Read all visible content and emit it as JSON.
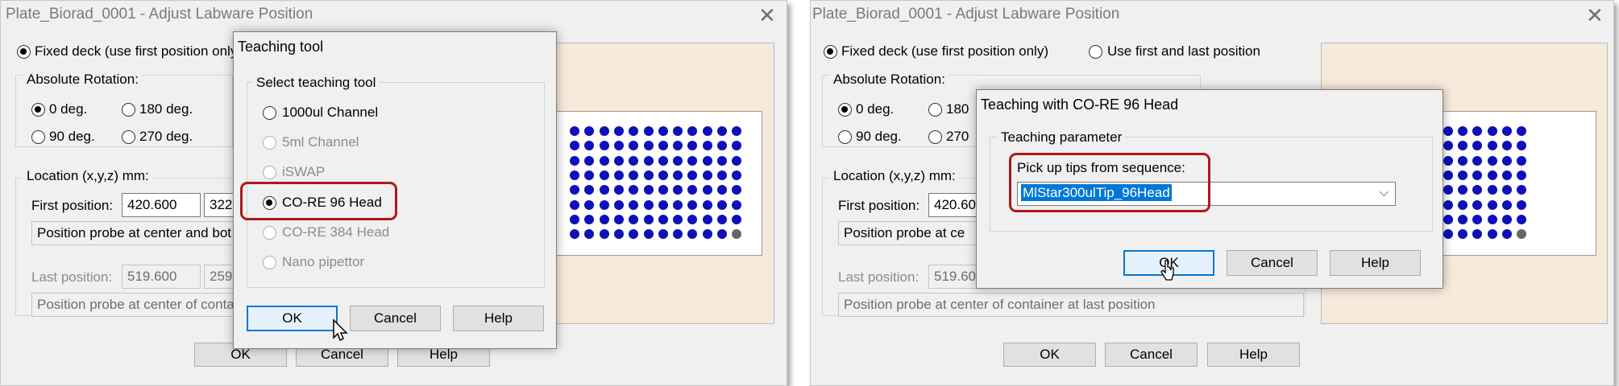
{
  "left": {
    "window_title": "Plate_Biorad_0001 - Adjust Labware Position",
    "fixed_deck_label": "Fixed deck (use first position only)",
    "absolute_rotation_label": "Absolute Rotation:",
    "rot_0": "0 deg.",
    "rot_180": "180 deg.",
    "rot_90": "90 deg.",
    "rot_270": "270 deg.",
    "location_label": "Location (x,y,z) mm:",
    "first_position_label": "First position:",
    "first_x": "420.600",
    "first_y": "322.",
    "first_probe": "Position probe at center and bot",
    "last_position_label": "Last position:",
    "last_x": "519.600",
    "last_y": "259.",
    "last_probe": "Position probe at center of conta",
    "ok": "OK",
    "cancel": "Cancel",
    "help": "Help",
    "teaching_dialog": {
      "title": "Teaching tool",
      "group_label": "Select teaching tool",
      "options": [
        {
          "label": "1000ul Channel",
          "enabled": true,
          "selected": false
        },
        {
          "label": "5ml Channel",
          "enabled": false,
          "selected": false
        },
        {
          "label": "iSWAP",
          "enabled": false,
          "selected": false
        },
        {
          "label": "CO-RE 96 Head",
          "enabled": true,
          "selected": true
        },
        {
          "label": "CO-RE 384 Head",
          "enabled": false,
          "selected": false
        },
        {
          "label": "Nano pipettor",
          "enabled": false,
          "selected": false
        }
      ],
      "ok": "OK",
      "cancel": "Cancel",
      "help": "Help"
    }
  },
  "right": {
    "window_title": "Plate_Biorad_0001 - Adjust Labware Position",
    "fixed_deck_label": "Fixed deck (use first position only)",
    "first_last_label": "Use first and last position",
    "absolute_rotation_label": "Absolute Rotation:",
    "rot_0": "0 deg.",
    "rot_180": "180",
    "rot_90": "90 deg.",
    "rot_270": "270",
    "location_label": "Location (x,y,z) mm:",
    "first_position_label": "First position:",
    "first_x": "420.60",
    "first_probe": "Position probe at ce",
    "last_position_label": "Last position:",
    "last_x": "519.60",
    "last_probe": "Position probe at center of container at last position",
    "ok": "OK",
    "cancel": "Cancel",
    "help": "Help",
    "teaching_dialog": {
      "title": "Teaching with CO-RE 96 Head",
      "group_label": "Teaching parameter",
      "sequence_label": "Pick up tips from sequence:",
      "sequence_value": "MlStar300ulTip_96Head",
      "ok": "OK",
      "cancel": "Cancel",
      "help": "Help"
    }
  },
  "colors": {
    "highlight": "#b01818",
    "well": "#0f10b8",
    "well_empty": "#666666",
    "deck": "#f7eadb",
    "selection": "#0078d7"
  },
  "icons": [
    "close-icon",
    "radio-icon",
    "chevron-down-icon",
    "mouse-cursor-icon"
  ]
}
